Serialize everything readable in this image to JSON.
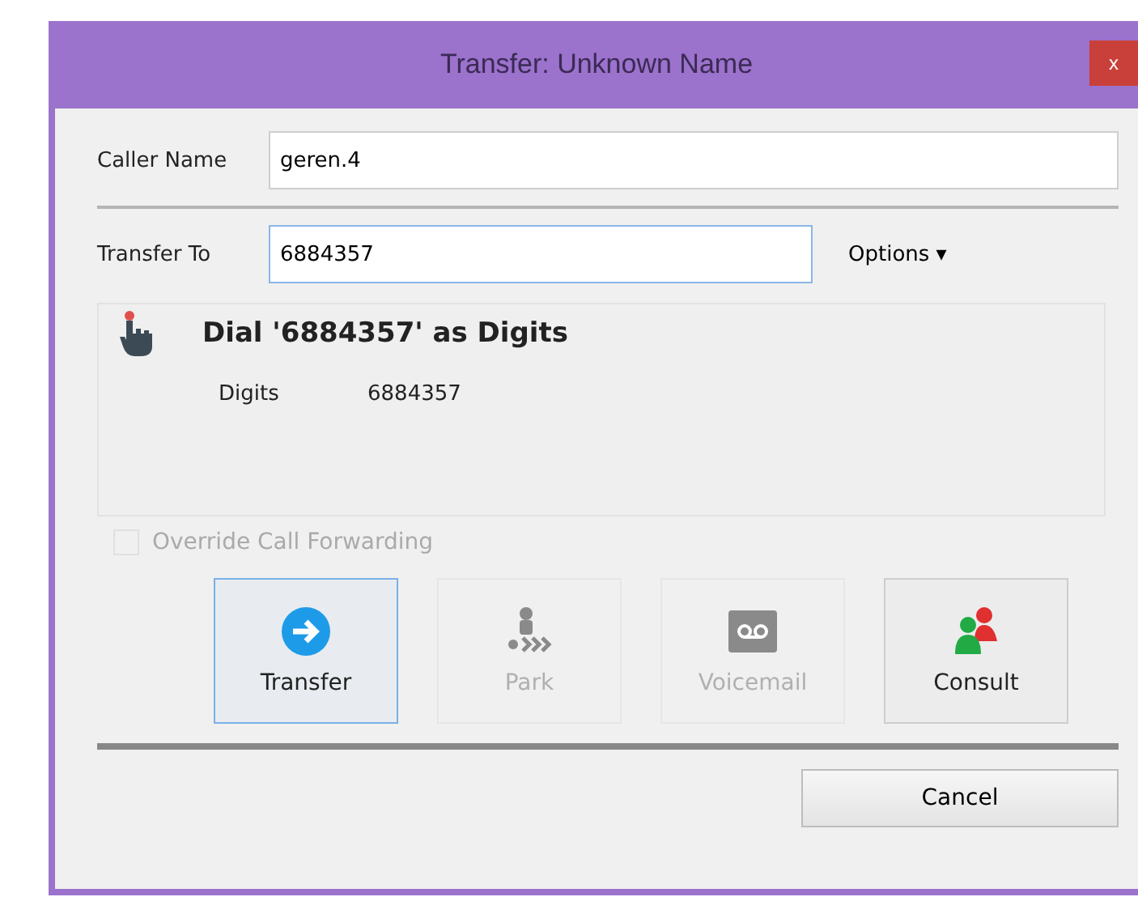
{
  "window": {
    "title": "Transfer: Unknown Name",
    "close": "x"
  },
  "caller": {
    "label": "Caller Name",
    "value": "geren.4"
  },
  "transfer_to": {
    "label": "Transfer To",
    "value": "6884357"
  },
  "options": {
    "label": "Options",
    "caret": "▾"
  },
  "result": {
    "title": "Dial '6884357' as Digits",
    "field_label": "Digits",
    "field_value": "6884357"
  },
  "override": {
    "label": "Override Call Forwarding",
    "checked": false,
    "disabled": true
  },
  "actions": [
    {
      "label": "Transfer",
      "kind": "transfer",
      "disabled": false,
      "selected": true
    },
    {
      "label": "Park",
      "kind": "park",
      "disabled": true,
      "selected": false
    },
    {
      "label": "Voicemail",
      "kind": "voicemail",
      "disabled": true,
      "selected": false
    },
    {
      "label": "Consult",
      "kind": "consult",
      "disabled": false,
      "selected": false
    }
  ],
  "cancel": "Cancel"
}
